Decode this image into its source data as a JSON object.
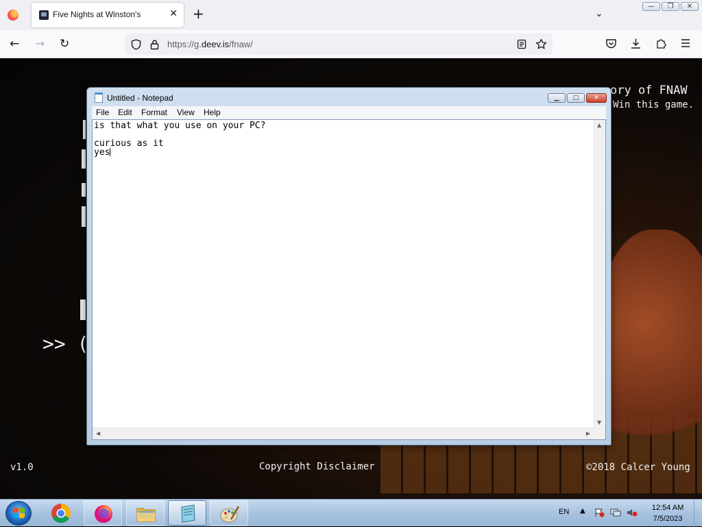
{
  "browser": {
    "tab": {
      "title": "Five Nights at Winston's",
      "close_glyph": "✕"
    },
    "new_tab_glyph": "+",
    "tab_list_glyph": "⌄",
    "window_controls": {
      "minimize": "—",
      "restore": "❐",
      "close": "✕"
    },
    "nav": {
      "back": "←",
      "forward": "→",
      "reload": "↻"
    },
    "url": {
      "prefix": "https://g.",
      "domain": "deev.is",
      "path": "/fnaw/"
    },
    "toolbar_icons": [
      "reader-view-icon",
      "bookmark-star-icon",
      "pocket-icon",
      "downloads-icon",
      "extensions-icon",
      "menu-icon"
    ]
  },
  "game": {
    "top_line_1": "ory of FNAW",
    "top_line_2": "Win this game.",
    "arrow": ">> (",
    "version": "v1.0",
    "disclaimer": "Copyright Disclaimer",
    "copyright": "©2018 Calcer Young"
  },
  "notepad": {
    "title": "Untitled - Notepad",
    "caption_buttons": {
      "minimize": "▁",
      "maximize": "□",
      "close": "✕"
    },
    "menu": [
      "File",
      "Edit",
      "Format",
      "View",
      "Help"
    ],
    "text_lines": [
      "is that what you use on your PC?",
      "",
      "curious as it",
      "yes"
    ]
  },
  "taskbar": {
    "items": [
      {
        "name": "chrome",
        "icon": "chrome-icon",
        "state": "pinned"
      },
      {
        "name": "firefox",
        "icon": "firefox-icon",
        "state": "running"
      },
      {
        "name": "explorer",
        "icon": "folder-icon",
        "state": "pinned"
      },
      {
        "name": "notepad",
        "icon": "notepad-icon",
        "state": "active"
      },
      {
        "name": "paint",
        "icon": "paint-icon",
        "state": "pinned"
      }
    ],
    "tray": {
      "language": "EN",
      "show_hidden": "▲",
      "time": "12:54 AM",
      "date": "7/5/2023"
    }
  }
}
